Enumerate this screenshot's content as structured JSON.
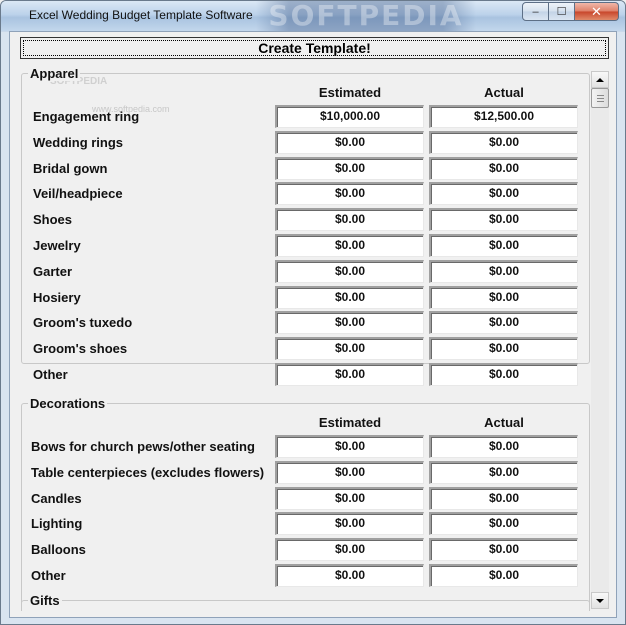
{
  "window": {
    "title": "Excel Wedding Budget Template Software",
    "watermark": "SOFTPEDIA",
    "watermark_small": "SOFTPEDIA",
    "watermark_url": "www.softpedia.com",
    "minimize_glyph": "–",
    "maximize_glyph": "☐",
    "close_glyph": "✕"
  },
  "toolbar": {
    "create_label": "Create Template!"
  },
  "columns": {
    "estimated": "Estimated",
    "actual": "Actual"
  },
  "apparel": {
    "title": "Apparel",
    "rows": [
      {
        "label": "Engagement ring",
        "estimated": "$10,000.00",
        "actual": "$12,500.00"
      },
      {
        "label": "Wedding rings",
        "estimated": "$0.00",
        "actual": "$0.00"
      },
      {
        "label": "Bridal gown",
        "estimated": "$0.00",
        "actual": "$0.00"
      },
      {
        "label": "Veil/headpiece",
        "estimated": "$0.00",
        "actual": "$0.00"
      },
      {
        "label": "Shoes",
        "estimated": "$0.00",
        "actual": "$0.00"
      },
      {
        "label": "Jewelry",
        "estimated": "$0.00",
        "actual": "$0.00"
      },
      {
        "label": "Garter",
        "estimated": "$0.00",
        "actual": "$0.00"
      },
      {
        "label": "Hosiery",
        "estimated": "$0.00",
        "actual": "$0.00"
      },
      {
        "label": "Groom's tuxedo",
        "estimated": "$0.00",
        "actual": "$0.00"
      },
      {
        "label": "Groom's shoes",
        "estimated": "$0.00",
        "actual": "$0.00"
      },
      {
        "label": "Other",
        "estimated": "$0.00",
        "actual": "$0.00"
      }
    ]
  },
  "decorations": {
    "title": "Decorations",
    "rows": [
      {
        "label": "Bows for church pews/other seating",
        "estimated": "$0.00",
        "actual": "$0.00"
      },
      {
        "label": "Table centerpieces (excludes flowers)",
        "estimated": "$0.00",
        "actual": "$0.00"
      },
      {
        "label": "Candles",
        "estimated": "$0.00",
        "actual": "$0.00"
      },
      {
        "label": "Lighting",
        "estimated": "$0.00",
        "actual": "$0.00"
      },
      {
        "label": "Balloons",
        "estimated": "$0.00",
        "actual": "$0.00"
      },
      {
        "label": "Other",
        "estimated": "$0.00",
        "actual": "$0.00"
      }
    ]
  },
  "gifts": {
    "title": "Gifts"
  }
}
